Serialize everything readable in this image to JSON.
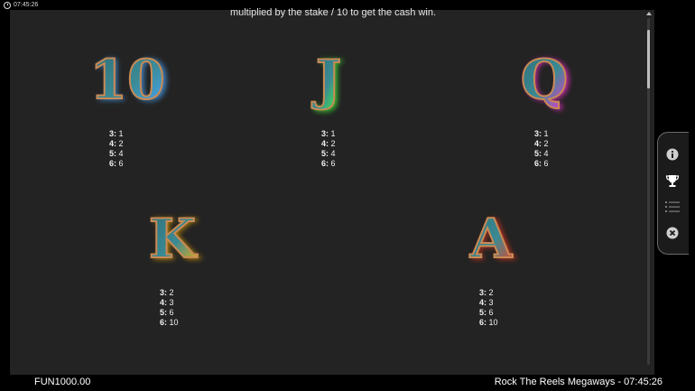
{
  "topbar": {
    "time": "07:45:26"
  },
  "intro_text": "multiplied by the stake / 10 to get the cash win.",
  "symbols": [
    {
      "letter": "10",
      "pays": [
        [
          "3:",
          "1"
        ],
        [
          "4:",
          "2"
        ],
        [
          "5:",
          "4"
        ],
        [
          "6:",
          "6"
        ]
      ],
      "glow": "#4aa8ff"
    },
    {
      "letter": "J",
      "pays": [
        [
          "3:",
          "1"
        ],
        [
          "4:",
          "2"
        ],
        [
          "5:",
          "4"
        ],
        [
          "6:",
          "6"
        ]
      ],
      "glow": "#42ff3a"
    },
    {
      "letter": "Q",
      "pays": [
        [
          "3:",
          "1"
        ],
        [
          "4:",
          "2"
        ],
        [
          "5:",
          "4"
        ],
        [
          "6:",
          "6"
        ]
      ],
      "glow": "#ff2fd6"
    },
    {
      "letter": "K",
      "pays": [
        [
          "3:",
          "2"
        ],
        [
          "4:",
          "3"
        ],
        [
          "5:",
          "6"
        ],
        [
          "6:",
          "10"
        ]
      ],
      "glow": "#ffb400"
    },
    {
      "letter": "A",
      "pays": [
        [
          "3:",
          "2"
        ],
        [
          "4:",
          "3"
        ],
        [
          "5:",
          "6"
        ],
        [
          "6:",
          "10"
        ]
      ],
      "glow": "#ff3a1a"
    }
  ],
  "sidebar": {
    "icons": [
      "info-icon",
      "trophy-icon",
      "list-icon",
      "close-icon"
    ]
  },
  "bottombar": {
    "balance": "FUN1000.00",
    "game_info": "Rock The Reels Megaways - 07:45:26"
  }
}
